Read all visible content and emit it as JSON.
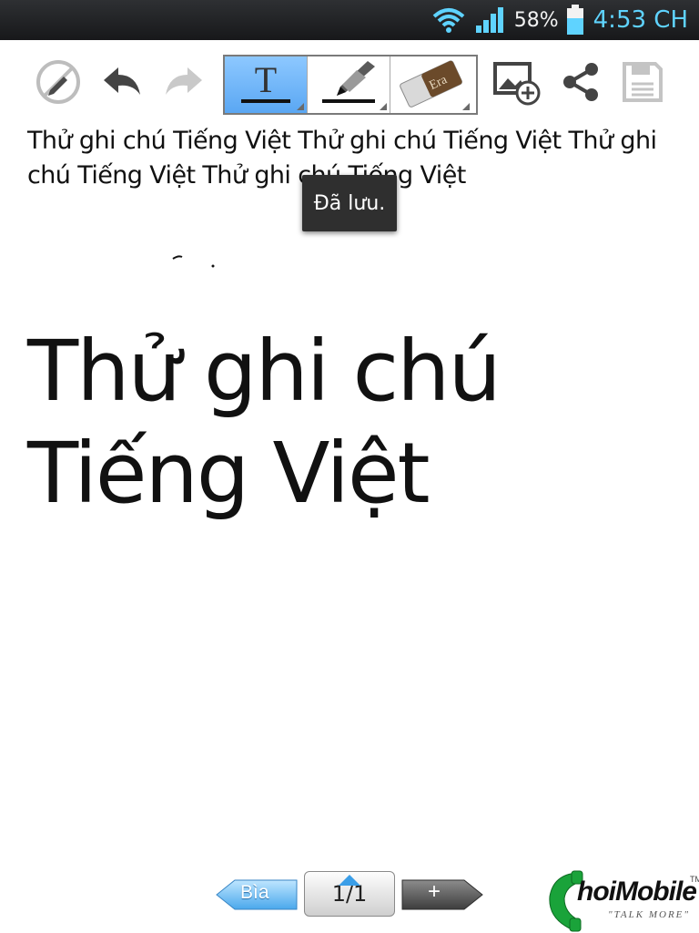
{
  "status_bar": {
    "battery_percent": "58%",
    "time": "4:53 CH",
    "icons": [
      "wifi-icon",
      "signal-icon",
      "battery-icon"
    ]
  },
  "toolbar": {
    "left_icons": [
      "pen-disabled-icon",
      "undo-icon",
      "redo-icon"
    ],
    "tools": [
      "text-tool-icon",
      "pen-tool-icon",
      "eraser-tool-icon"
    ],
    "active_tool": "text-tool-icon",
    "eraser_label": "Era",
    "right_icons": [
      "insert-image-icon",
      "share-icon",
      "save-icon"
    ]
  },
  "note": {
    "small_text": "Thử ghi chú Tiếng Việt Thử ghi chú Tiếng Việt Thử ghi chú Tiếng Việt Thử ghi chú Tiếng Việt",
    "big_text": "Thử ghi chú Tiếng Việt"
  },
  "toast": {
    "text": "Đã lưu."
  },
  "bottom_nav": {
    "cover_label": "Bìa",
    "page_indicator": "1/1",
    "add_label": "+"
  },
  "branding": {
    "logo_text": "hoiMobile",
    "logo_tm": "TM",
    "tagline": "\"TALK MORE\""
  },
  "colors": {
    "accent_blue": "#5aa7f3",
    "time_blue": "#5fd3ff",
    "logo_green": "#1aa33a"
  }
}
